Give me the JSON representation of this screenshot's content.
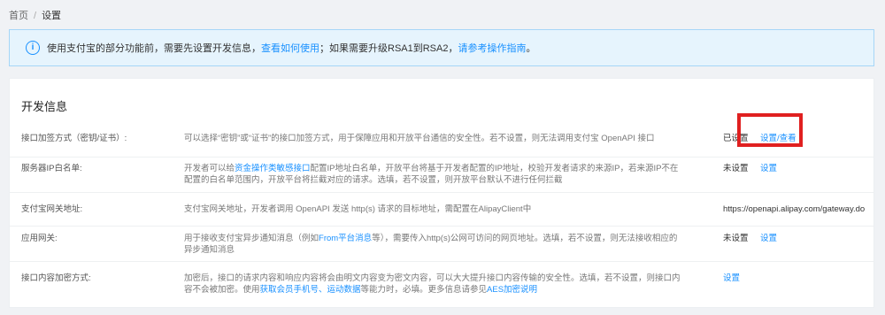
{
  "breadcrumb": {
    "home": "首页",
    "separator": "/",
    "current": "设置"
  },
  "notice": {
    "text1": "使用支付宝的部分功能前，需要先设置开发信息，",
    "link1": "查看如何使用",
    "text2": "；如果需要升级RSA1到RSA2，",
    "link2": "请参考操作指南",
    "text3": "。"
  },
  "panel": {
    "title": "开发信息",
    "rows": [
      {
        "label": "接口加签方式（密钥/证书）:",
        "desc": "可以选择“密钥”或“证书”的接口加签方式，用于保障应用和开放平台通信的安全性。若不设置，则无法调用支付宝 OpenAPI 接口",
        "status": "已设置",
        "action": "设置/查看"
      },
      {
        "label": "服务器IP白名单:",
        "desc_pre": "开发者可以给",
        "desc_link": "资金操作类敏感接口",
        "desc_post": "配置IP地址白名单，开放平台将基于开发者配置的IP地址，校验开发者请求的来源IP，若来源IP不在配置的白名单范围内，开放平台将拦截对应的请求。选填，若不设置，则开放平台默认不进行任何拦截",
        "status": "未设置",
        "action": "设置"
      },
      {
        "label": "支付宝网关地址:",
        "desc": "支付宝网关地址，开发者调用 OpenAPI 发送 http(s) 请求的目标地址，需配置在AlipayClient中",
        "value": "https://openapi.alipay.com/gateway.do"
      },
      {
        "label": "应用网关:",
        "desc_pre": "用于接收支付宝异步通知消息（例如",
        "desc_link": "From平台消息",
        "desc_post": "等），需要传入http(s)公网可访问的网页地址。选填，若不设置，则无法接收相应的异步通知消息",
        "status": "未设置",
        "action": "设置"
      },
      {
        "label": "接口内容加密方式:",
        "desc_pre": "加密后，接口的请求内容和响应内容将会由明文内容变为密文内容，可以大大提升接口内容传输的安全性。选填，若不设置，则接口内容不会被加密。使用",
        "desc_link": "获取会员手机号、运动数据",
        "desc_mid": "等能力时，必填。更多信息请参见",
        "desc_link2": "AES加密说明",
        "action": "设置"
      }
    ]
  },
  "colors": {
    "accent": "#1890ff",
    "highlight": "#e02020",
    "notice_bg": "#e6f4fd"
  }
}
